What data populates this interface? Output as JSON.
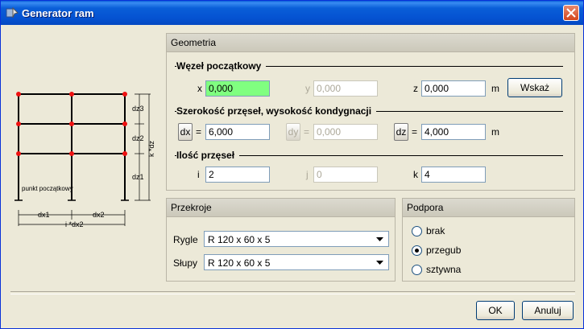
{
  "window": {
    "title": "Generator ram"
  },
  "geometry": {
    "header": "Geometria",
    "start_node": {
      "title": "Węzeł początkowy",
      "x_label": "x",
      "x_value": "0,000",
      "y_label": "y",
      "y_value": "0,000",
      "z_label": "z",
      "z_value": "0,000",
      "unit": "m",
      "show_button": "Wskaż"
    },
    "spans": {
      "title": "Szerokość przęseł, wysokość kondygnacji",
      "dx_button": "dx",
      "dx_value": "6,000",
      "dy_button": "dy",
      "dy_value": "0,000",
      "dz_button": "dz",
      "dz_value": "4,000",
      "eq": "=",
      "unit": "m"
    },
    "count": {
      "title": "Ilość przęseł",
      "i_label": "i",
      "i_value": "2",
      "j_label": "j",
      "j_value": "0",
      "k_label": "k",
      "k_value": "4"
    }
  },
  "sections": {
    "header": "Przekroje",
    "beams_label": "Rygle",
    "beams_value": "R 120 x 60 x 5",
    "columns_label": "Słupy",
    "columns_value": "R 120 x 60 x 5"
  },
  "support": {
    "header": "Podpora",
    "options": [
      "brak",
      "przegub",
      "sztywna"
    ],
    "selected": "przegub"
  },
  "diagram": {
    "dz3": "dz3",
    "dz2": "dz2",
    "dz1": "dz1",
    "kdz": "k *dz",
    "dx1": "dx1",
    "dx2": "dx2",
    "idx2": "i *dx2",
    "start_point": "punkt początkowy"
  },
  "footer": {
    "ok": "OK",
    "cancel": "Anuluj"
  }
}
